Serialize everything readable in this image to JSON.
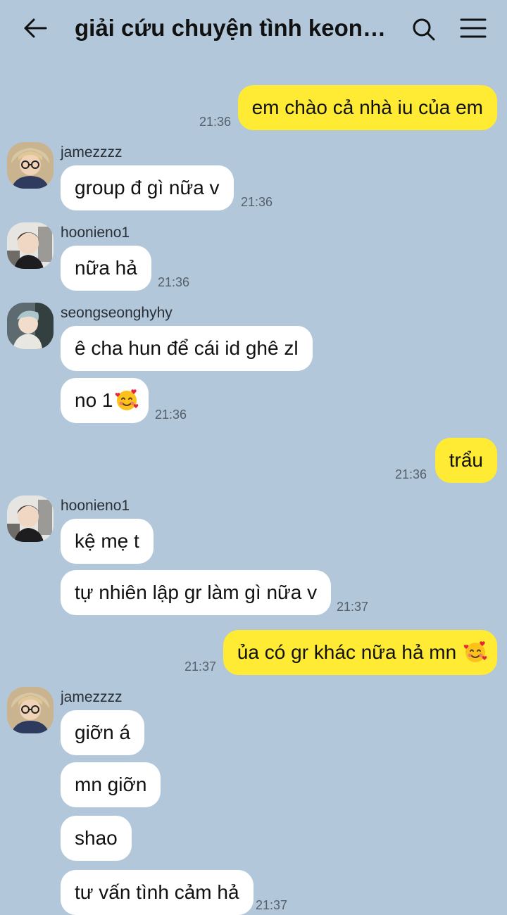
{
  "header": {
    "title": "giải cứu chuyện tình keonh...",
    "back_icon": "back-arrow-icon",
    "search_icon": "search-icon",
    "menu_icon": "hamburger-menu-icon"
  },
  "colors": {
    "background": "#b2c7d9",
    "incoming_bubble": "#ffffff",
    "outgoing_bubble": "#ffeb33"
  },
  "messages": [
    {
      "direction": "out",
      "text": "em chào cả nhà iu của em",
      "time": "21:36"
    },
    {
      "direction": "in",
      "sender": "jamezzzz",
      "text": "group đ gì nữa v",
      "time": "21:36"
    },
    {
      "direction": "in",
      "sender": "hoonieno1",
      "text": "nữa hả",
      "time": "21:36"
    },
    {
      "direction": "in",
      "sender": "seongseonghyhy",
      "text": "ê cha hun để cái id ghê zl"
    },
    {
      "direction": "in",
      "text": "no 1",
      "emoji": "smiling-face-with-hearts-icon",
      "time": "21:36"
    },
    {
      "direction": "out",
      "text": "trẩu",
      "time": "21:36"
    },
    {
      "direction": "in",
      "sender": "hoonieno1",
      "text": "kệ mẹ t"
    },
    {
      "direction": "in",
      "text": "tự nhiên lập gr làm gì nữa v",
      "time": "21:37"
    },
    {
      "direction": "out",
      "text": "ủa có gr khác nữa hả mn",
      "emoji": "smiling-face-with-hearts-icon",
      "time": "21:37"
    },
    {
      "direction": "in",
      "sender": "jamezzzz",
      "text": "giỡn á"
    },
    {
      "direction": "in",
      "text": "mn giỡn"
    },
    {
      "direction": "in",
      "text": "shao"
    },
    {
      "direction": "in",
      "text": "tư vấn tình cảm hả",
      "time": "21:37"
    }
  ]
}
